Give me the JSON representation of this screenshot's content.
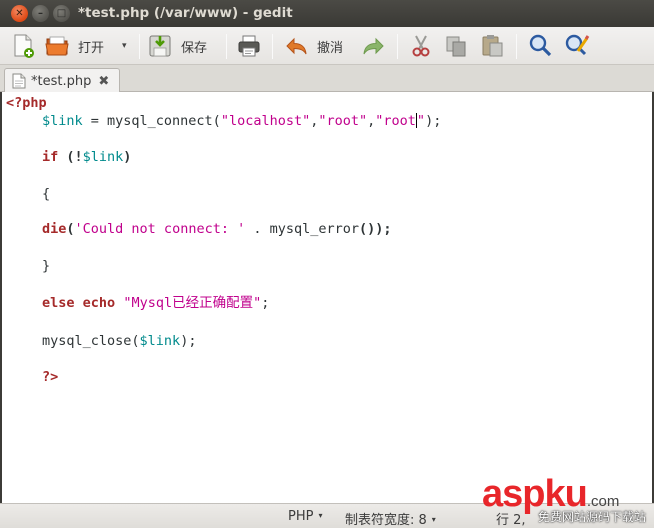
{
  "window": {
    "title": "*test.php (/var/www) - gedit",
    "close_glyph": "✕",
    "minimize_glyph": "–",
    "maximize_glyph": "□"
  },
  "toolbar": {
    "new_icon": "new-document-icon",
    "open_label": "打开",
    "open_dropdown_glyph": "▾",
    "save_label": "保存",
    "print_icon": "print-icon",
    "undo_label": "撤消",
    "redo_icon": "redo-icon",
    "cut_icon": "cut-icon",
    "copy_icon": "copy-icon",
    "paste_icon": "paste-icon",
    "find_icon": "find-icon",
    "replace_icon": "find-replace-icon"
  },
  "tab": {
    "label": "*test.php",
    "close_glyph": "✖"
  },
  "editor": {
    "line1": "<?php",
    "line2": {
      "var": "$link",
      "op": " = mysql_connect(",
      "s1": "\"localhost\"",
      "c1": ",",
      "s2": "\"root\"",
      "c2": ",",
      "s3a": "\"root",
      "s3b": "\"",
      "end": ");"
    },
    "line3": {
      "kw": "if",
      "open": " (!",
      "var": "$link",
      "close": ")"
    },
    "line4": "{",
    "line5": {
      "kw": "die",
      "open": "(",
      "str": "'Could not connect: '",
      "mid": " . mysql_error",
      "end": "());"
    },
    "line6": "}",
    "line7": {
      "kw1": "else",
      "kw2": "echo",
      "str": "\"Mysql已经正确配置\"",
      "end": ";"
    },
    "line8": {
      "fn": "mysql_close(",
      "var": "$link",
      "end": ");"
    },
    "line9": "?>"
  },
  "statusbar": {
    "language": "PHP",
    "tab_width": "制表符宽度: 8",
    "dropdown_glyph": "▾",
    "position": "行 2,"
  },
  "watermark": {
    "main_a": "asp",
    "main_ku": "ku",
    "main_com": ".com",
    "sub": "免费网站源码下载站"
  },
  "colors": {
    "keyword": "#a52a2a",
    "variable": "#008a8c",
    "string": "#c0008c",
    "close_button": "#dd4814",
    "title_bar": "#3c3b37"
  }
}
